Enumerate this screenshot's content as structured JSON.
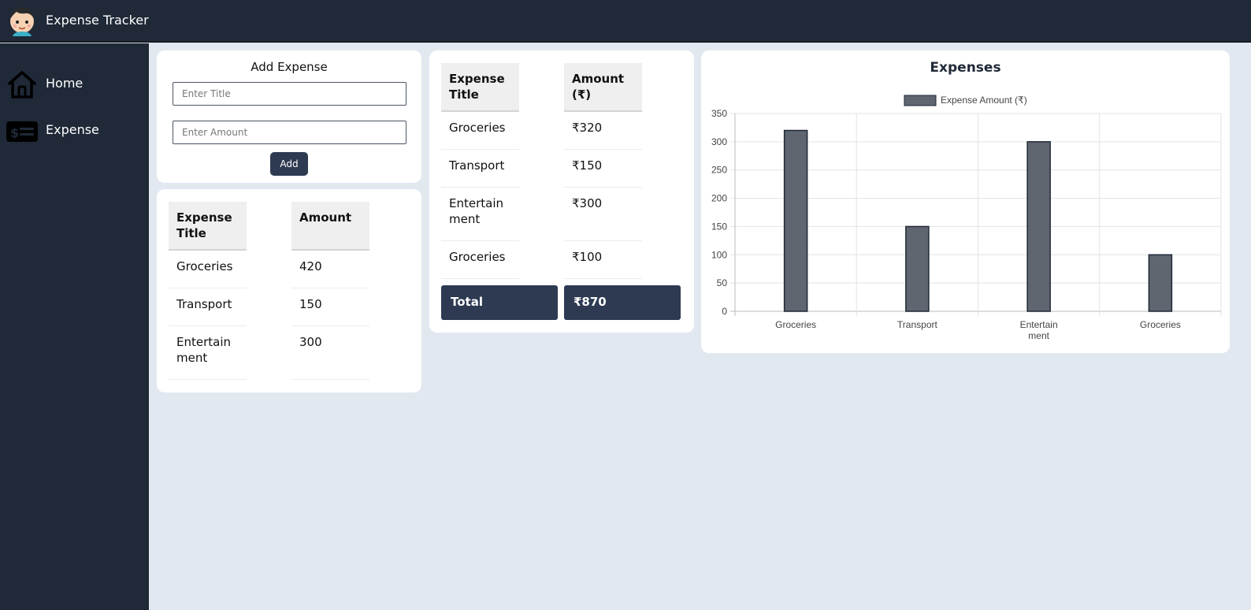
{
  "app": {
    "title": "Expense Tracker"
  },
  "sidebar": {
    "items": [
      {
        "label": "Home",
        "icon": "home-icon"
      },
      {
        "label": "Expense",
        "icon": "dollar-list-icon"
      }
    ]
  },
  "add_form": {
    "title": "Add Expense",
    "title_placeholder": "Enter Title",
    "amount_placeholder": "Enter Amount",
    "button_label": "Add"
  },
  "table1": {
    "headers": [
      "Expense Title",
      "Amount"
    ],
    "rows": [
      [
        "Groceries",
        "420"
      ],
      [
        "Transport",
        "150"
      ],
      [
        "Entertainment",
        "300"
      ]
    ]
  },
  "table2": {
    "headers": [
      "Expense Title",
      "Amount (₹)"
    ],
    "rows": [
      [
        "Groceries",
        "₹320"
      ],
      [
        "Transport",
        "₹150"
      ],
      [
        "Entertainment",
        "₹300"
      ],
      [
        "Groceries",
        "₹100"
      ]
    ],
    "total_label": "Total",
    "total_value": "₹870"
  },
  "chart_data": {
    "type": "bar",
    "title": "Expenses",
    "categories": [
      "Groceries",
      "Transport",
      "Entertainment",
      "Groceries"
    ],
    "series": [
      {
        "name": "Expense Amount (₹)",
        "values": [
          320,
          150,
          300,
          100
        ]
      }
    ],
    "yticks": [
      "0",
      "50",
      "100",
      "150",
      "200",
      "250",
      "300",
      "350"
    ],
    "ylim": [
      0,
      350
    ],
    "grid": true,
    "legend": "top",
    "bar_color": "#5f6670",
    "bar_border": "#1f2937"
  },
  "colors": {
    "sidebar_bg": "#1f2937",
    "page_bg": "#e2e8f0",
    "accent": "#2d3a52"
  }
}
